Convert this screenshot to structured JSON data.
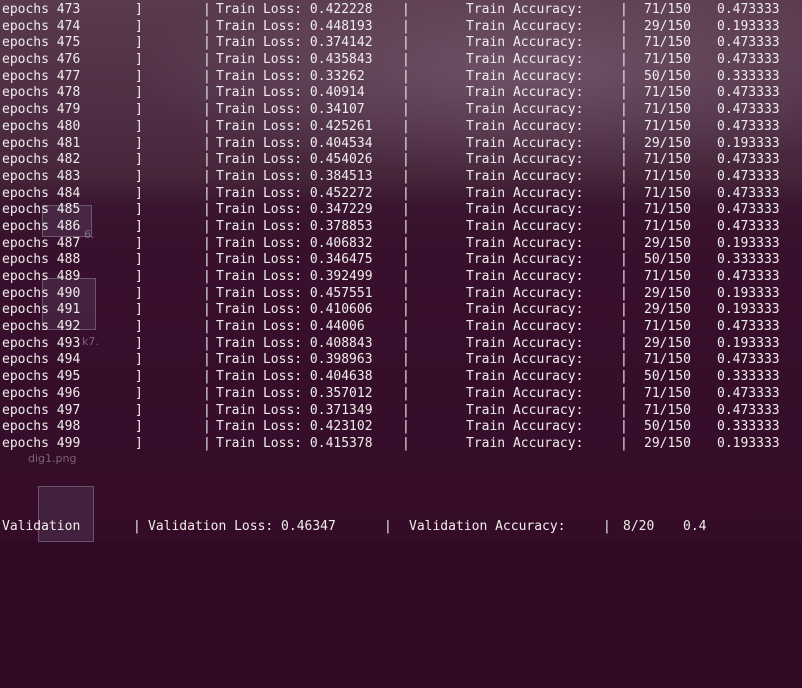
{
  "rows": [
    {
      "epoch": "epochs 473",
      "loss": "Train Loss: 0.422228",
      "acc_label": "Train Accuracy:",
      "frac": "71/150",
      "value": "0.473333"
    },
    {
      "epoch": "epochs 474",
      "loss": "Train Loss: 0.448193",
      "acc_label": "Train Accuracy:",
      "frac": "29/150",
      "value": "0.193333"
    },
    {
      "epoch": "epochs 475",
      "loss": "Train Loss: 0.374142",
      "acc_label": "Train Accuracy:",
      "frac": "71/150",
      "value": "0.473333"
    },
    {
      "epoch": "epochs 476",
      "loss": "Train Loss: 0.435843",
      "acc_label": "Train Accuracy:",
      "frac": "71/150",
      "value": "0.473333"
    },
    {
      "epoch": "epochs 477",
      "loss": "Train Loss: 0.33262",
      "acc_label": "Train Accuracy:",
      "frac": "50/150",
      "value": "0.333333"
    },
    {
      "epoch": "epochs 478",
      "loss": "Train Loss: 0.40914",
      "acc_label": "Train Accuracy:",
      "frac": "71/150",
      "value": "0.473333"
    },
    {
      "epoch": "epochs 479",
      "loss": "Train Loss: 0.34107",
      "acc_label": "Train Accuracy:",
      "frac": "71/150",
      "value": "0.473333"
    },
    {
      "epoch": "epochs 480",
      "loss": "Train Loss: 0.425261",
      "acc_label": "Train Accuracy:",
      "frac": "71/150",
      "value": "0.473333"
    },
    {
      "epoch": "epochs 481",
      "loss": "Train Loss: 0.404534",
      "acc_label": "Train Accuracy:",
      "frac": "29/150",
      "value": "0.193333"
    },
    {
      "epoch": "epochs 482",
      "loss": "Train Loss: 0.454026",
      "acc_label": "Train Accuracy:",
      "frac": "71/150",
      "value": "0.473333"
    },
    {
      "epoch": "epochs 483",
      "loss": "Train Loss: 0.384513",
      "acc_label": "Train Accuracy:",
      "frac": "71/150",
      "value": "0.473333"
    },
    {
      "epoch": "epochs 484",
      "loss": "Train Loss: 0.452272",
      "acc_label": "Train Accuracy:",
      "frac": "71/150",
      "value": "0.473333"
    },
    {
      "epoch": "epochs 485",
      "loss": "Train Loss: 0.347229",
      "acc_label": "Train Accuracy:",
      "frac": "71/150",
      "value": "0.473333"
    },
    {
      "epoch": "epochs 486",
      "loss": "Train Loss: 0.378853",
      "acc_label": "Train Accuracy:",
      "frac": "71/150",
      "value": "0.473333"
    },
    {
      "epoch": "epochs 487",
      "loss": "Train Loss: 0.406832",
      "acc_label": "Train Accuracy:",
      "frac": "29/150",
      "value": "0.193333"
    },
    {
      "epoch": "epochs 488",
      "loss": "Train Loss: 0.346475",
      "acc_label": "Train Accuracy:",
      "frac": "50/150",
      "value": "0.333333"
    },
    {
      "epoch": "epochs 489",
      "loss": "Train Loss: 0.392499",
      "acc_label": "Train Accuracy:",
      "frac": "71/150",
      "value": "0.473333"
    },
    {
      "epoch": "epochs 490",
      "loss": "Train Loss: 0.457551",
      "acc_label": "Train Accuracy:",
      "frac": "29/150",
      "value": "0.193333"
    },
    {
      "epoch": "epochs 491",
      "loss": "Train Loss: 0.410606",
      "acc_label": "Train Accuracy:",
      "frac": "29/150",
      "value": "0.193333"
    },
    {
      "epoch": "epochs 492",
      "loss": "Train Loss: 0.44006",
      "acc_label": "Train Accuracy:",
      "frac": "71/150",
      "value": "0.473333"
    },
    {
      "epoch": "epochs 493",
      "loss": "Train Loss: 0.408843",
      "acc_label": "Train Accuracy:",
      "frac": "29/150",
      "value": "0.193333"
    },
    {
      "epoch": "epochs 494",
      "loss": "Train Loss: 0.398963",
      "acc_label": "Train Accuracy:",
      "frac": "71/150",
      "value": "0.473333"
    },
    {
      "epoch": "epochs 495",
      "loss": "Train Loss: 0.404638",
      "acc_label": "Train Accuracy:",
      "frac": "50/150",
      "value": "0.333333"
    },
    {
      "epoch": "epochs 496",
      "loss": "Train Loss: 0.357012",
      "acc_label": "Train Accuracy:",
      "frac": "71/150",
      "value": "0.473333"
    },
    {
      "epoch": "epochs 497",
      "loss": "Train Loss: 0.371349",
      "acc_label": "Train Accuracy:",
      "frac": "71/150",
      "value": "0.473333"
    },
    {
      "epoch": "epochs 498",
      "loss": "Train Loss: 0.423102",
      "acc_label": "Train Accuracy:",
      "frac": "50/150",
      "value": "0.333333"
    },
    {
      "epoch": "epochs 499",
      "loss": "Train Loss: 0.415378",
      "acc_label": "Train Accuracy:",
      "frac": "29/150",
      "value": "0.193333"
    }
  ],
  "separators": {
    "bracket": "]",
    "bar": "|"
  },
  "validation": {
    "label": "Validation",
    "loss": "Validation Loss: 0.46347",
    "acc_label": "Validation Accuracy:",
    "frac": "8/20",
    "value": "0.4"
  },
  "desktop": {
    "icon_label": "dig1.png",
    "partial_labels": [
      "6.",
      "k7."
    ]
  },
  "colors": {
    "terminal_bg": "#300a24",
    "text": "#eeeeec"
  }
}
